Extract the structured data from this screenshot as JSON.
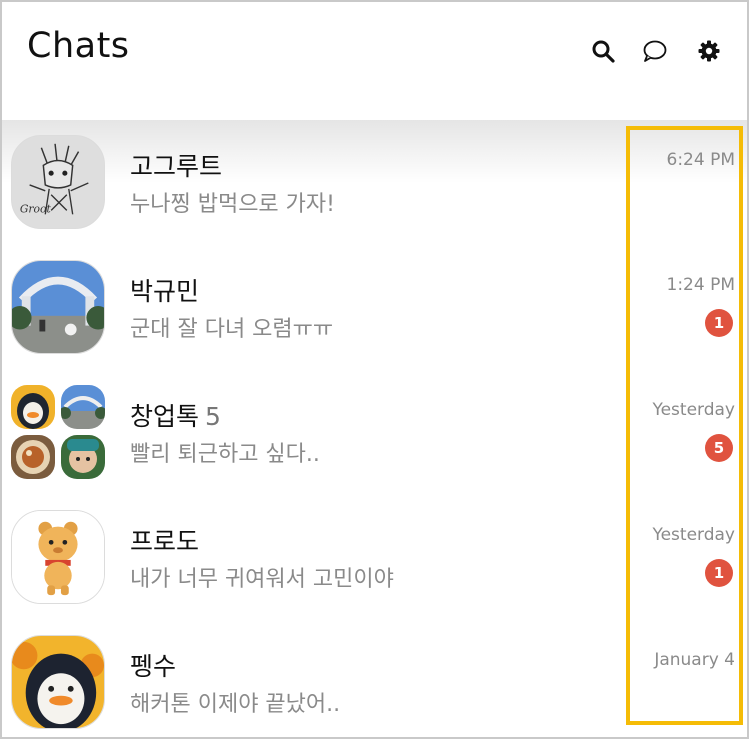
{
  "header": {
    "title": "Chats",
    "icons": [
      "search-icon",
      "chat-bubble-icon",
      "gear-icon"
    ]
  },
  "chats": [
    {
      "name": "고그루트",
      "count": "",
      "preview": "누나찡 밥먹으로 가자!",
      "time": "6:24 PM",
      "badge": "",
      "avatar": "groot-drawing"
    },
    {
      "name": "박규민",
      "count": "",
      "preview": "군대 잘 다녀 오렴ㅠㅠ",
      "time": "1:24 PM",
      "badge": "1",
      "avatar": "gate-photo"
    },
    {
      "name": "창업톡",
      "count": "5",
      "preview": "빨리 퇴근하고 싶다..",
      "time": "Yesterday",
      "badge": "5",
      "avatar": "group"
    },
    {
      "name": "프로도",
      "count": "",
      "preview": "내가 너무 귀여워서 고민이야",
      "time": "Yesterday",
      "badge": "1",
      "avatar": "frodo-character"
    },
    {
      "name": "펭수",
      "count": "",
      "preview": "해커톤 이제야 끝났어..",
      "time": "January 4",
      "badge": "",
      "avatar": "pengsoo"
    }
  ],
  "colors": {
    "badge": "#e0533f",
    "highlight": "#f5bc06",
    "muted_text": "#8a8a8a"
  }
}
